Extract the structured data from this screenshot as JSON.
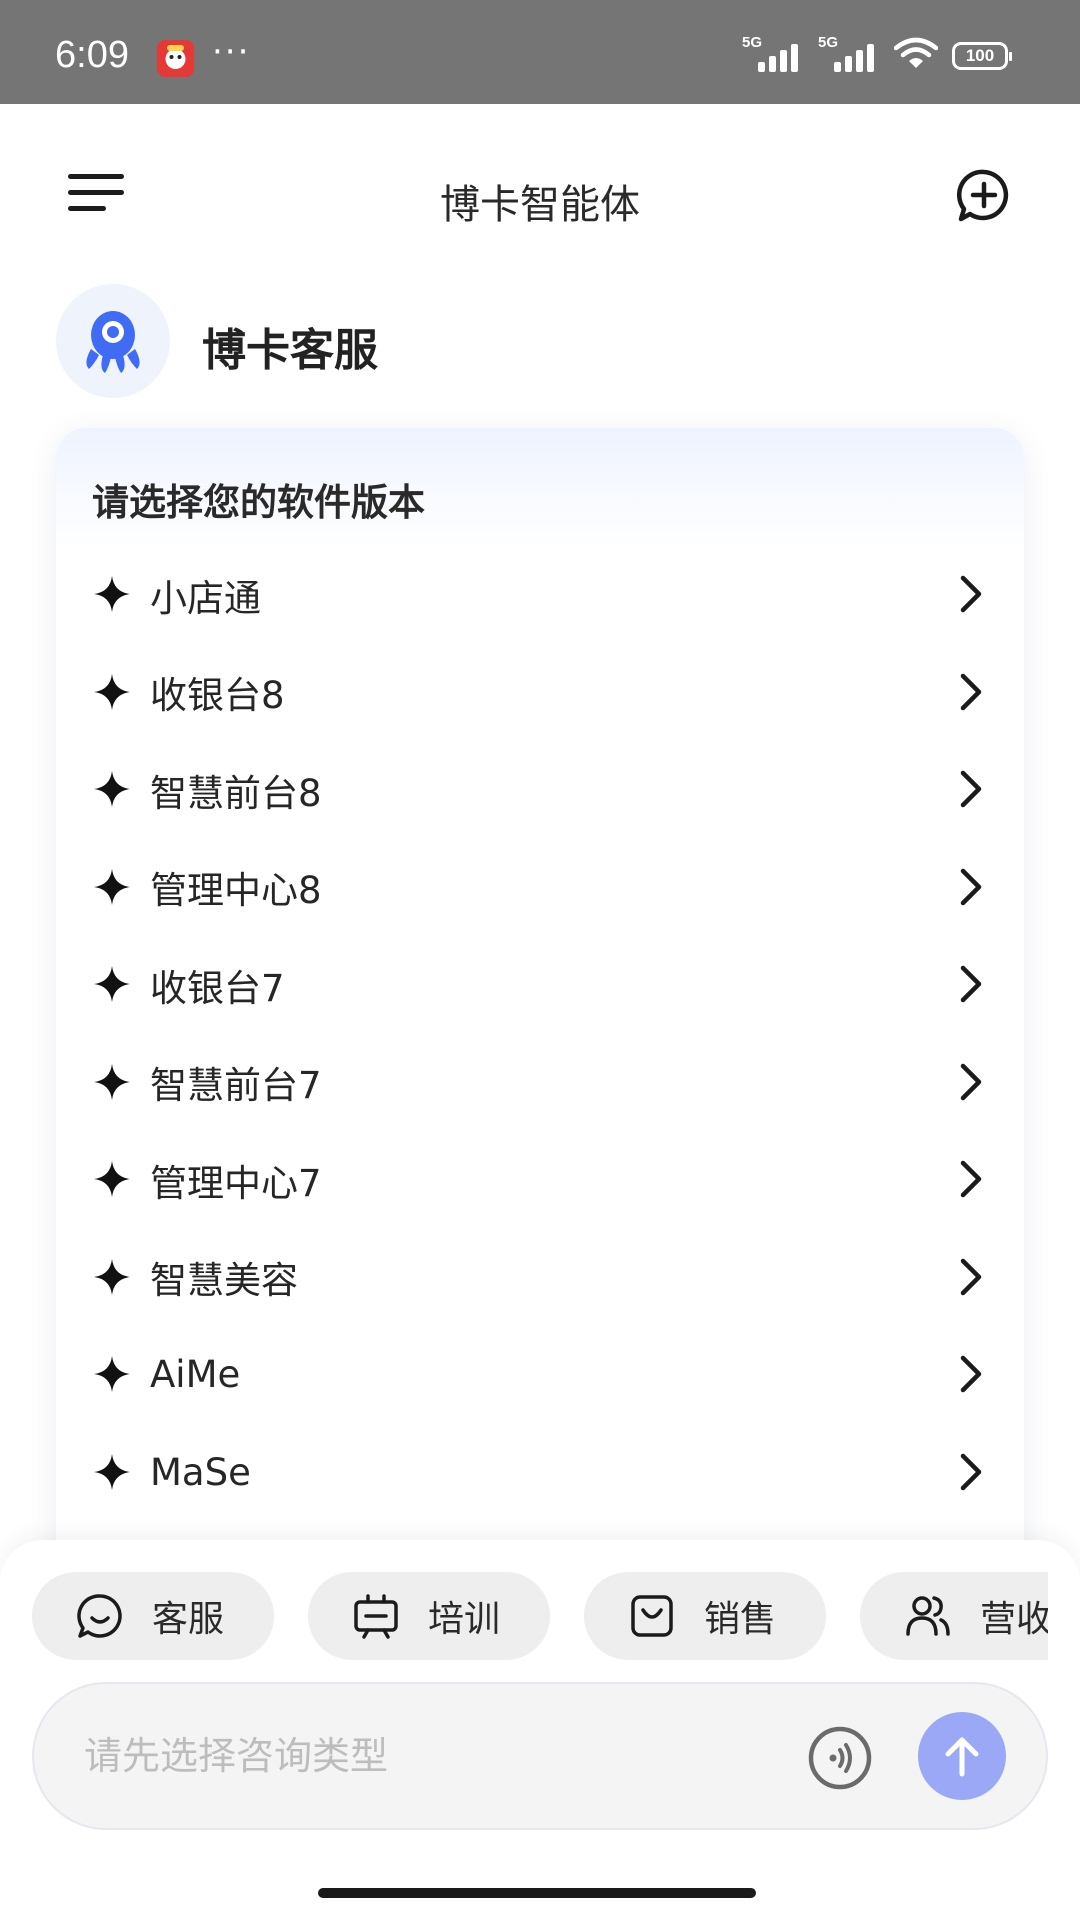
{
  "status_bar": {
    "time": "6:09",
    "dots": "···",
    "network_1": "5G",
    "network_2": "5G",
    "battery": "100"
  },
  "header": {
    "title": "博卡智能体"
  },
  "agent": {
    "name": "博卡客服"
  },
  "card": {
    "title": "请选择您的软件版本",
    "options": [
      {
        "label": "小店通"
      },
      {
        "label": "收银台8"
      },
      {
        "label": "智慧前台8"
      },
      {
        "label": "管理中心8"
      },
      {
        "label": "收银台7"
      },
      {
        "label": "智慧前台7"
      },
      {
        "label": "管理中心7"
      },
      {
        "label": "智慧美容"
      },
      {
        "label": "AiMe"
      },
      {
        "label": "MaSe"
      }
    ]
  },
  "chips": [
    {
      "label": "客服",
      "icon": "chat-smile-icon"
    },
    {
      "label": "培训",
      "icon": "training-board-icon"
    },
    {
      "label": "销售",
      "icon": "shopping-bag-icon"
    },
    {
      "label": "营收",
      "icon": "users-icon"
    }
  ],
  "input": {
    "placeholder": "请先选择咨询类型"
  },
  "colors": {
    "status_bar": "#757575",
    "accent_avatar": "#3f6bf5",
    "send_button": "#9aa8f5",
    "chip_bg": "#eeeeee"
  }
}
